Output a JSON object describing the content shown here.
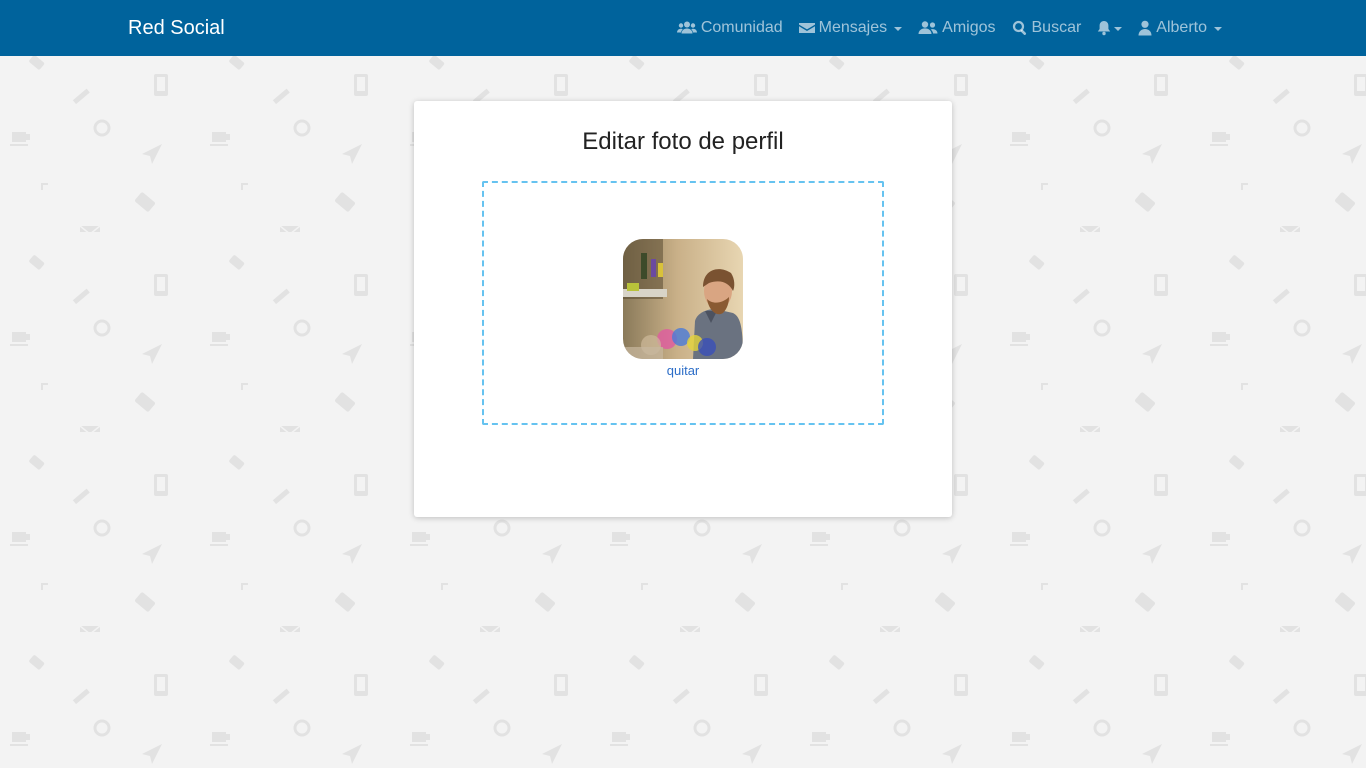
{
  "navbar": {
    "brand": "Red Social",
    "items": [
      {
        "label": "Comunidad",
        "icon": "users-icon",
        "dropdown": false
      },
      {
        "label": "Mensajes",
        "icon": "envelope-icon",
        "dropdown": true
      },
      {
        "label": "Amigos",
        "icon": "user-friends-icon",
        "dropdown": false
      },
      {
        "label": "Buscar",
        "icon": "search-icon",
        "dropdown": false
      },
      {
        "label": "",
        "icon": "bell-icon",
        "dropdown": true
      },
      {
        "label": "Alberto",
        "icon": "user-icon",
        "dropdown": true
      }
    ],
    "color": "#00639c"
  },
  "card": {
    "title": "Editar foto de perfil",
    "dropzone": {
      "remove_label": "quitar",
      "border_color": "#66c3f0"
    }
  },
  "colors": {
    "page_background": "#f3f3f3",
    "link": "#2d6ec8"
  }
}
